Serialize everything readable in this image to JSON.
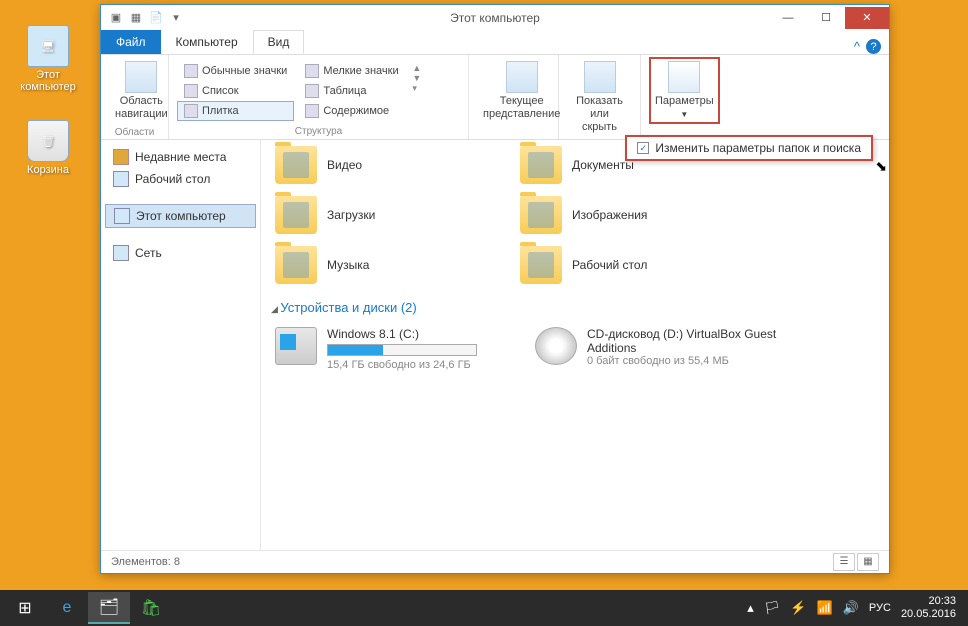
{
  "desktop": {
    "computer_label": "Этот компьютер",
    "trash_label": "Корзина"
  },
  "window": {
    "title": "Этот компьютер",
    "tabs": {
      "file": "Файл",
      "computer": "Компьютер",
      "view": "Вид"
    },
    "ribbon": {
      "nav_pane": "Область навигации",
      "areas_label": "Области",
      "layout": {
        "normal_icons": "Обычные значки",
        "small_icons": "Мелкие значки",
        "list": "Список",
        "table": "Таблица",
        "tiles": "Плитка",
        "content": "Содержимое"
      },
      "structure_label": "Структура",
      "current_view": "Текущее представление",
      "show_hide": "Показать или скрыть",
      "options": "Параметры",
      "options_menu": "Изменить параметры папок и поиска"
    },
    "sidebar": {
      "recent": "Недавние места",
      "desktop": "Рабочий стол",
      "this_pc": "Этот компьютер",
      "network": "Сеть"
    },
    "content": {
      "devices_hdr": "Устройства и диски (2)",
      "folders": {
        "video": "Видео",
        "documents": "Документы",
        "downloads": "Загрузки",
        "pictures": "Изображения",
        "music": "Музыка",
        "desktop": "Рабочий стол"
      },
      "drives": {
        "c": {
          "name": "Windows 8.1 (C:)",
          "sub": "15,4 ГБ свободно из 24,6 ГБ",
          "fill_pct": 37
        },
        "d": {
          "name": "CD-дисковод (D:) VirtualBox Guest Additions",
          "sub": "0 байт свободно из 55,4 МБ"
        }
      }
    },
    "status": {
      "elements": "Элементов: 8"
    }
  },
  "taskbar": {
    "lang": "РУС",
    "time": "20:33",
    "date": "20.05.2016"
  }
}
